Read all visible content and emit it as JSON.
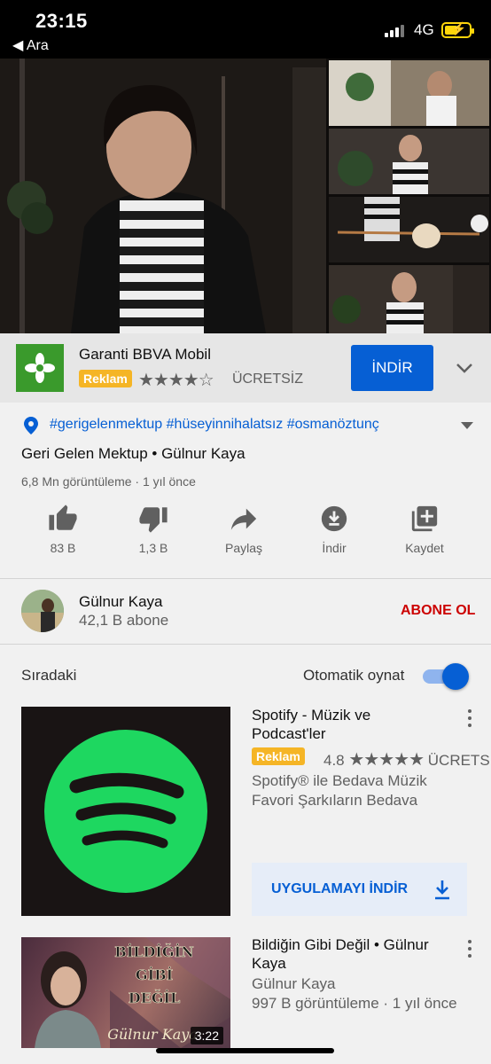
{
  "status_bar": {
    "time": "23:15",
    "back_label": "◀ Ara",
    "network": "4G"
  },
  "player": {
    "progress_fraction": 0.04
  },
  "ad_banner": {
    "title": "Garanti BBVA Mobil",
    "badge": "Reklam",
    "stars": "★★★★☆",
    "price": "ÜCRETSİZ",
    "install_label": "İNDİR"
  },
  "video": {
    "hashtags": "#gerigelenmektup #hüseyinnihalatsız #osmanöztunç",
    "title": "Geri Gelen Mektup • Gülnur Kaya",
    "views": "6,8 Mn görüntüleme · 1 yıl önce"
  },
  "actions": [
    {
      "label": "83 B",
      "icon": "thumbs-up-icon"
    },
    {
      "label": "1,3 B",
      "icon": "thumbs-down-icon"
    },
    {
      "label": "Paylaş",
      "icon": "share-icon"
    },
    {
      "label": "İndir",
      "icon": "download-icon"
    },
    {
      "label": "Kaydet",
      "icon": "save-playlist-icon"
    }
  ],
  "channel": {
    "name": "Gülnur Kaya",
    "subscribers": "42,1 B abone",
    "subscribe_label": "ABONE OL"
  },
  "up_next": {
    "label": "Sıradaki",
    "autoplay_label": "Otomatik oynat",
    "autoplay_on": true
  },
  "spotify_ad": {
    "title": "Spotify - Müzik ve Podcast'ler",
    "badge": "Reklam",
    "rating": "4.8",
    "stars": "★★★★★",
    "price": "ÜCRETS",
    "description": "Spotify® ile Bedava Müzik Favori Şarkıların Bedava",
    "install_label": "UYGULAMAYI İNDİR"
  },
  "next_video": {
    "title": "Bildiğin Gibi Değil • Gülnur Kaya",
    "channel": "Gülnur Kaya",
    "views": "997 B görüntüleme · 1 yıl önce",
    "duration": "3:22",
    "thumb_text_1": "BİLDİĞİN",
    "thumb_text_2": "GİBİ",
    "thumb_text_3": "DEĞİL",
    "thumb_signature": "Gülnur Kaya"
  },
  "colors": {
    "accent_blue": "#065fd4",
    "subscribe_red": "#cc0000",
    "ad_yellow": "#f5b526",
    "spotify_green": "#1ed760"
  }
}
